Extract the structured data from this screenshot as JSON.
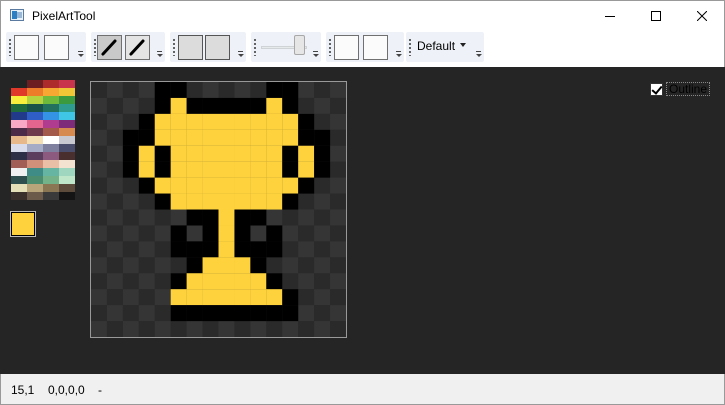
{
  "window": {
    "title": "PixelArtTool"
  },
  "toolbar": {
    "palette_combo_value": "Default"
  },
  "palette": {
    "columns": 4,
    "colors": [
      "#222323",
      "#6d1e21",
      "#ad2b2b",
      "#c8344b",
      "#e0392a",
      "#ee7d29",
      "#f6a832",
      "#f1c636",
      "#f7ef3b",
      "#b5d33e",
      "#6dba3d",
      "#3b9a3e",
      "#1f6b3b",
      "#185248",
      "#22705e",
      "#2e9d8f",
      "#213a8a",
      "#2f5ec6",
      "#3593e6",
      "#3fc6e6",
      "#f9a8c5",
      "#e4658e",
      "#b03c8f",
      "#7e2c7a",
      "#4c2b48",
      "#6e3a4c",
      "#a35a4a",
      "#d68a4f",
      "#e7b98a",
      "#f4dfb4",
      "#ffffff",
      "#c9c9d2",
      "#d8dceb",
      "#a5adc6",
      "#7f7fa0",
      "#4c4e6e",
      "#2d2f46",
      "#5b3d5e",
      "#8c5a7f",
      "#4a2f2f",
      "#a15e56",
      "#d0907a",
      "#e9bfa5",
      "#f3e2d0",
      "#f1f1f1",
      "#3f8c86",
      "#66b5a3",
      "#9ed6c0",
      "#2f4f4f",
      "#4c8c6f",
      "#74b38a",
      "#bfe6c8",
      "#e6e0b8",
      "#b9a57a",
      "#8a7652",
      "#5c4b3a",
      "#3a2f2a",
      "#6b5a4a",
      "#3a3a3a",
      "#141414"
    ],
    "current_color": "#fdd23c"
  },
  "canvas": {
    "grid_size": 16,
    "checker_light": "#353535",
    "checker_dark": "#2a2a2a",
    "legend": {
      ".": "transparent",
      "Y": "#fdd23c",
      "K": "#000000"
    },
    "pixels": [
      "....KK.....KK...",
      "....KYKKKKKYK...",
      "...KYYYYYYYYYK..",
      "..KKYYYYYYYYYKK.",
      "..KYKYYYYYYYKYK.",
      "..KYKYYYYYYYKYK.",
      "...KYYYYYYYYYK..",
      "....KYYYYYYYK...",
      "......KKYKK.....",
      ".....K.KYK.K....",
      ".....KKKYKKK....",
      "......KYYYK.....",
      ".....KYYYYYK....",
      ".....YYYYYYYK...",
      ".....KKKKKKKK...",
      "................"
    ]
  },
  "options": {
    "outline_label": "Outline",
    "outline_checked": true
  },
  "status": {
    "coords": "15,1",
    "rgba": "0,0,0,0",
    "extra": "-"
  }
}
